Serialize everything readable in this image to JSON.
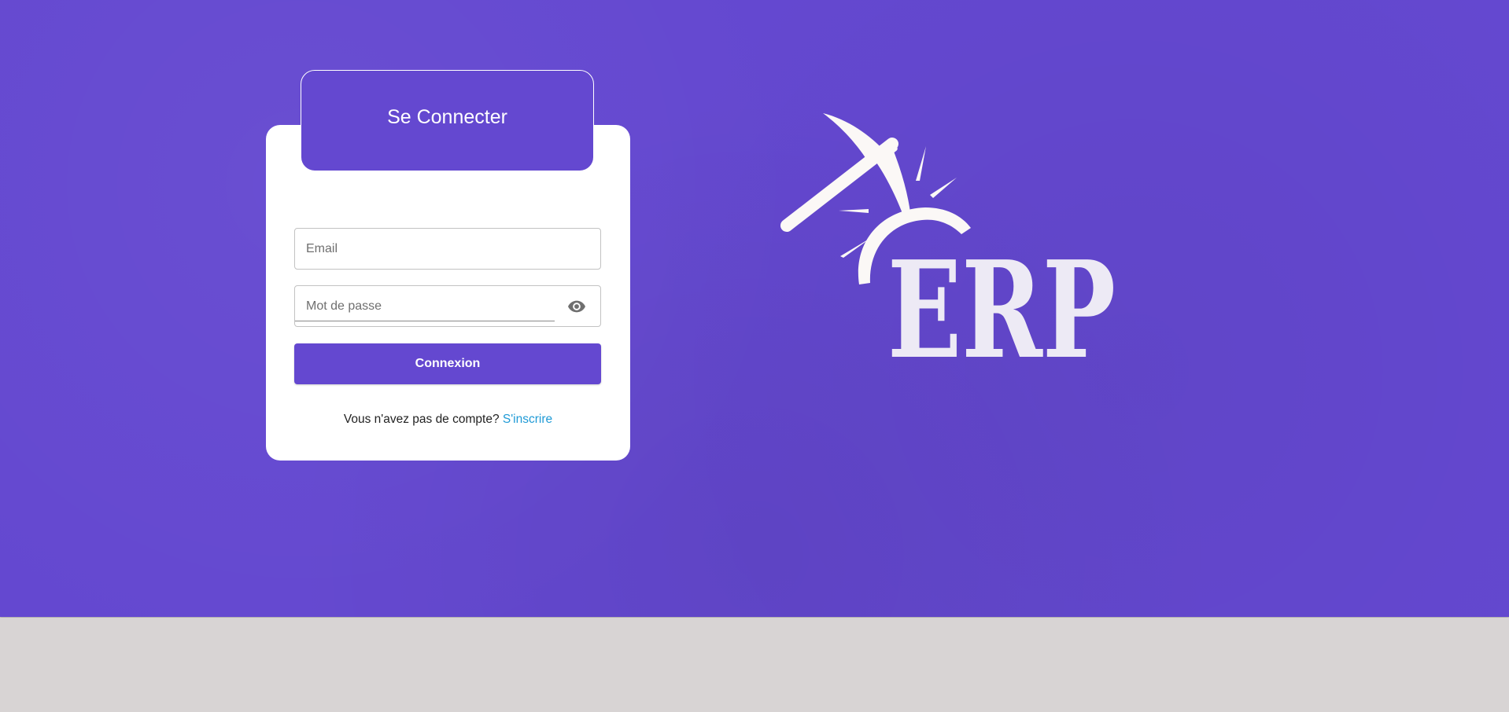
{
  "login": {
    "title": "Se Connecter",
    "email_placeholder": "Email",
    "password_placeholder": "Mot de passe",
    "submit_label": "Connexion",
    "no_account_text": "Vous n'avez pas de compte? ",
    "signup_link": "S'inscrire"
  },
  "logo": {
    "text": "ERP",
    "icon": "pickaxe-icon"
  },
  "colors": {
    "primary": "#6448d0",
    "link": "#1f9ad6",
    "card": "#ffffff",
    "page_bottom": "#d8d4d4"
  }
}
